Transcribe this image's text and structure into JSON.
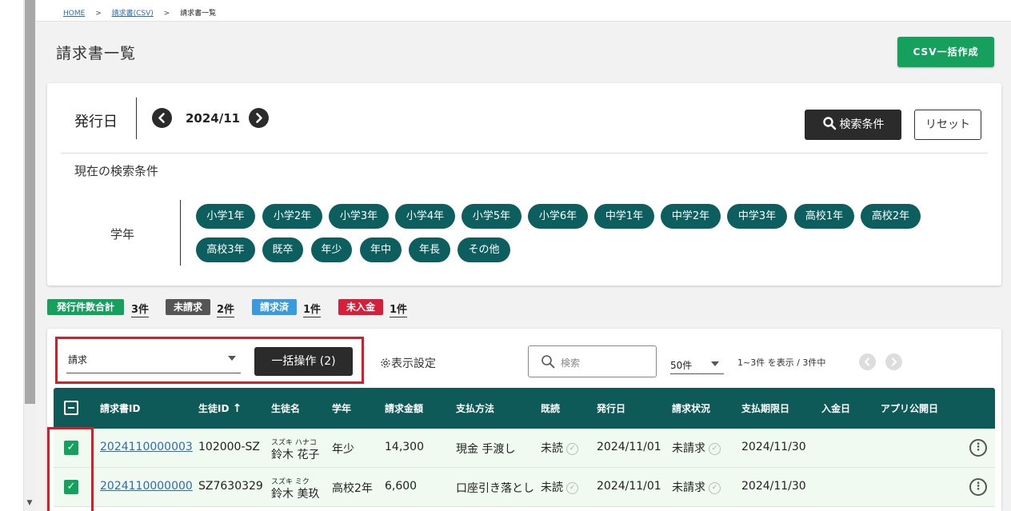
{
  "breadcrumb": {
    "home": "HOME",
    "parent": "請求書(CSV)",
    "current": "請求書一覧",
    "separator": ">"
  },
  "page": {
    "title": "請求書一覧",
    "csv_button": "CSV一括作成"
  },
  "filters": {
    "issue_date_label": "発行日",
    "month": "2024/11",
    "prev_icon": "chevron-left-icon",
    "next_icon": "chevron-right-icon",
    "search_button": "検索条件",
    "reset_button": "リセット",
    "current_conditions_label": "現在の検索条件",
    "grade_label": "学年",
    "grades": [
      "小学1年",
      "小学2年",
      "小学3年",
      "小学4年",
      "小学5年",
      "小学6年",
      "中学1年",
      "中学2年",
      "中学3年",
      "高校1年",
      "高校2年",
      "高校3年",
      "既卒",
      "年少",
      "年中",
      "年長",
      "その他"
    ]
  },
  "stats": [
    {
      "label": "発行件数合計",
      "value": "3件",
      "color": "#16a05d"
    },
    {
      "label": "未請求",
      "value": "2件",
      "color": "#555555"
    },
    {
      "label": "請求済",
      "value": "1件",
      "color": "#3a9ae0"
    },
    {
      "label": "未入金",
      "value": "1件",
      "color": "#d6203a"
    }
  ],
  "toolbar": {
    "select_value": "請求",
    "bulk_button": "一括操作 (2)",
    "display_setting": "表示設定",
    "search_placeholder": "検索",
    "per_page": "50件",
    "range_text": "1~3件 を表示 / 3件中"
  },
  "table": {
    "headers": [
      "請求書ID",
      "生徒ID",
      "生徒名",
      "学年",
      "請求金額",
      "支払方法",
      "既読",
      "発行日",
      "請求状況",
      "支払期限日",
      "入金日",
      "アプリ公開日"
    ],
    "sort_indicator": "↑",
    "rows": [
      {
        "invoice_id": "2024110000003",
        "student_id": "102000-SZ",
        "kana": "スズキ ハナコ",
        "name": "鈴木 花子",
        "grade": "年少",
        "amount": "14,300",
        "payment": "現金 手渡し",
        "read": "未読",
        "issued": "2024/11/01",
        "status": "未請求",
        "due": "2024/11/30",
        "paid": "",
        "published": ""
      },
      {
        "invoice_id": "2024110000000",
        "student_id": "SZ7630329",
        "kana": "スズキ ミク",
        "name": "鈴木 美玖",
        "grade": "高校2年",
        "amount": "6,600",
        "payment": "口座引き落とし",
        "read": "未読",
        "issued": "2024/11/01",
        "status": "未請求",
        "due": "2024/11/30",
        "paid": "",
        "published": ""
      }
    ]
  }
}
